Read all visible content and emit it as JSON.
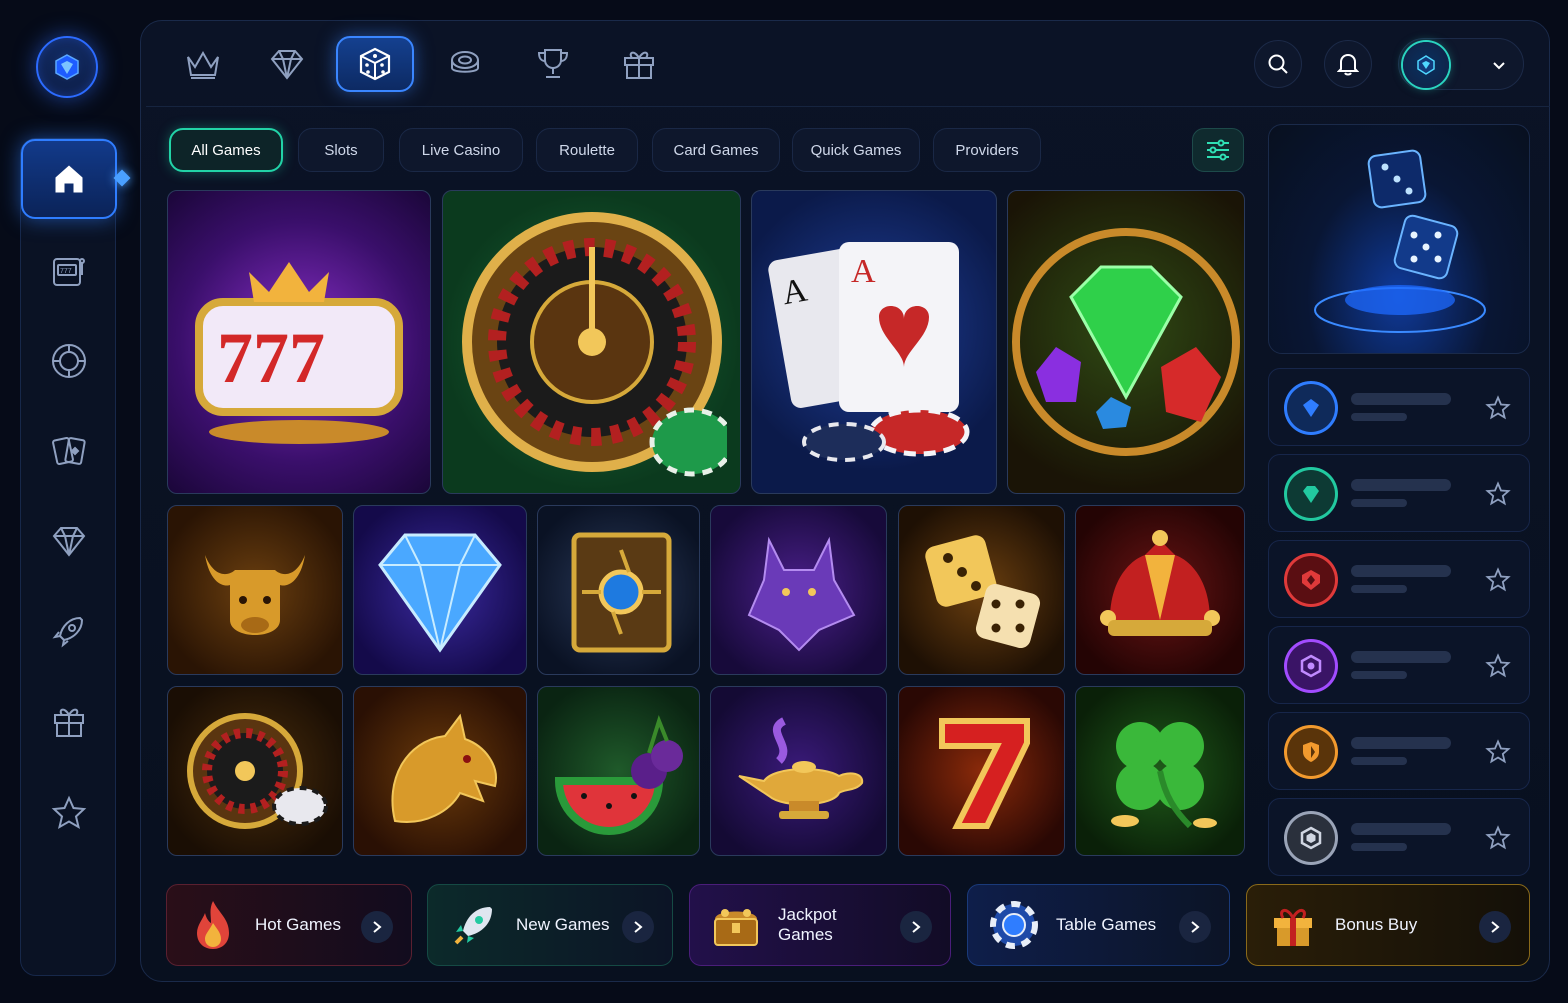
{
  "colors": {
    "accent_blue": "#2f7dff",
    "accent_teal": "#22d3a7",
    "background": "#060b18",
    "gold": "#f2b33d"
  },
  "left_rail": {
    "items": [
      {
        "icon": "home-icon",
        "active": true
      },
      {
        "icon": "slot-machine-icon",
        "active": false
      },
      {
        "icon": "roulette-icon",
        "active": false
      },
      {
        "icon": "cards-icon",
        "active": false
      },
      {
        "icon": "diamond-icon",
        "active": false
      },
      {
        "icon": "rocket-icon",
        "active": false
      },
      {
        "icon": "gift-icon",
        "active": false
      },
      {
        "icon": "star-icon",
        "active": false
      }
    ]
  },
  "top_nav": {
    "items": [
      {
        "icon": "crown-icon",
        "active": false
      },
      {
        "icon": "diamond-icon",
        "active": false
      },
      {
        "icon": "dice-icon",
        "active": true
      },
      {
        "icon": "chip-icon",
        "active": false
      },
      {
        "icon": "trophy-icon",
        "active": false
      },
      {
        "icon": "gift-icon",
        "active": false
      }
    ]
  },
  "filters": [
    {
      "label": "All Games",
      "active": true
    },
    {
      "label": "Slots",
      "active": false
    },
    {
      "label": "Live Casino",
      "active": false
    },
    {
      "label": "Roulette",
      "active": false
    },
    {
      "label": "Card Games",
      "active": false
    },
    {
      "label": "Quick Games",
      "active": false
    },
    {
      "label": "Providers",
      "active": false
    }
  ],
  "games": {
    "featured": [
      {
        "icon": "slot-777-icon"
      },
      {
        "icon": "roulette-wheel-icon"
      },
      {
        "icon": "playing-cards-icon"
      },
      {
        "icon": "gems-icon"
      }
    ],
    "row2": [
      {
        "icon": "bull-icon"
      },
      {
        "icon": "blue-diamond-icon"
      },
      {
        "icon": "magic-book-icon"
      },
      {
        "icon": "wolf-icon"
      },
      {
        "icon": "golden-dice-icon"
      },
      {
        "icon": "jester-hat-icon"
      }
    ],
    "row3": [
      {
        "icon": "mini-roulette-icon"
      },
      {
        "icon": "dragon-icon"
      },
      {
        "icon": "fruits-icon"
      },
      {
        "icon": "magic-lamp-icon"
      },
      {
        "icon": "lucky-seven-icon"
      },
      {
        "icon": "clover-icon"
      }
    ]
  },
  "favorites": [
    {
      "badge_color": "#2f7dff"
    },
    {
      "badge_color": "#22c9a0"
    },
    {
      "badge_color": "#e03a3a"
    },
    {
      "badge_color": "#a24cff"
    },
    {
      "badge_color": "#f29a2e"
    },
    {
      "badge_color": "#9aa4b8"
    }
  ],
  "categories": [
    {
      "label": "Hot Games",
      "icon": "fire-icon",
      "color": "#e0443a"
    },
    {
      "label": "New Games",
      "icon": "rocket-icon",
      "color": "#22c9a0"
    },
    {
      "label": "Jackpot Games",
      "label_line1": "Jackpot",
      "label_line2": "Games",
      "icon": "treasure-chest-icon",
      "color": "#a24cff"
    },
    {
      "label": "Table Games",
      "icon": "poker-chip-icon",
      "color": "#2f7dff"
    },
    {
      "label": "Bonus Buy",
      "icon": "gift-box-icon",
      "color": "#f2b33d"
    }
  ]
}
